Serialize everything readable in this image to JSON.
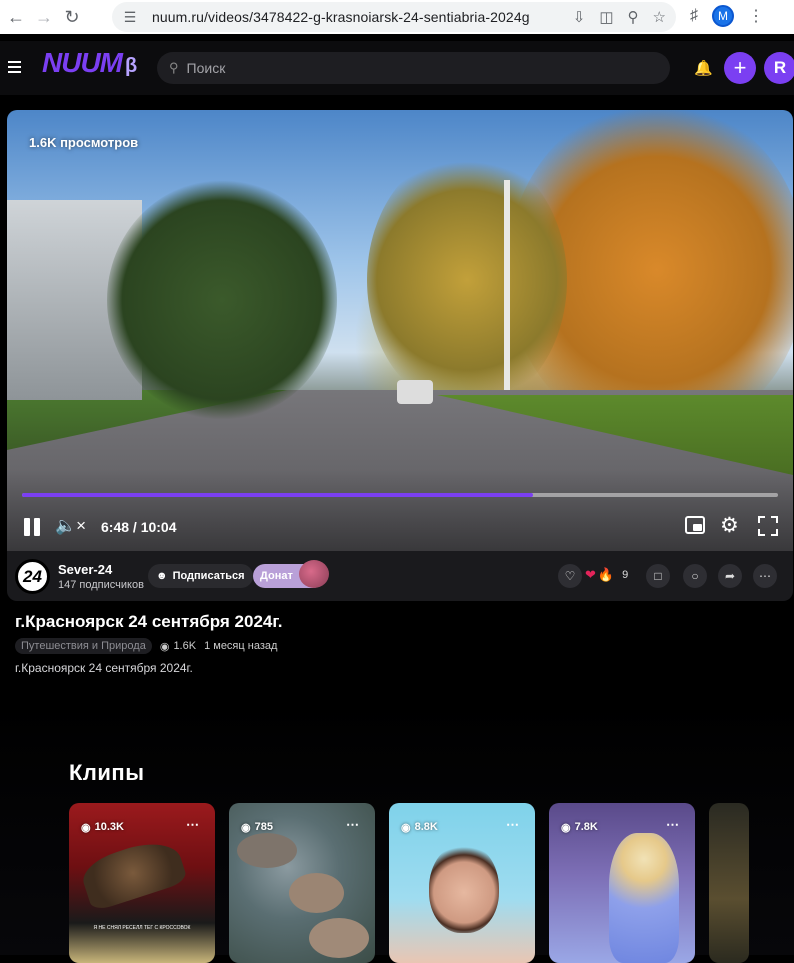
{
  "browser": {
    "url": "nuum.ru/videos/3478422-g-krasnoiarsk-24-sentiabria-2024g",
    "profile_initial": "M"
  },
  "header": {
    "logo": "NUUM",
    "logo_badge": "β",
    "search_placeholder": "Поиск",
    "user_initial": "R",
    "accent": "#7b3ff2"
  },
  "player": {
    "views_overlay": "1.6K просмотров",
    "timecode": "6:48 / 10:04",
    "progress": 0.676
  },
  "channel": {
    "avatar_text": "24",
    "name": "Sever-24",
    "subscribers": "147 подписчиков",
    "subscribe_label": "Подписаться",
    "donate_label": "Донат",
    "reactions_count": "9"
  },
  "video": {
    "title": "г.Красноярск 24 сентября 2024г.",
    "category": "Путешествия и Природа",
    "views": "1.6K",
    "posted": "1 месяц назад",
    "description": "г.Красноярск 24 сентября 2024г."
  },
  "clips": {
    "title": "Клипы",
    "items": [
      {
        "views": "10.3K",
        "caption": "Я НЕ СНЯЛ РЕСЕЛЛ ТЕГ С КРОССОВОК"
      },
      {
        "views": "785"
      },
      {
        "views": "8.8K"
      },
      {
        "views": "7.8K"
      }
    ]
  }
}
